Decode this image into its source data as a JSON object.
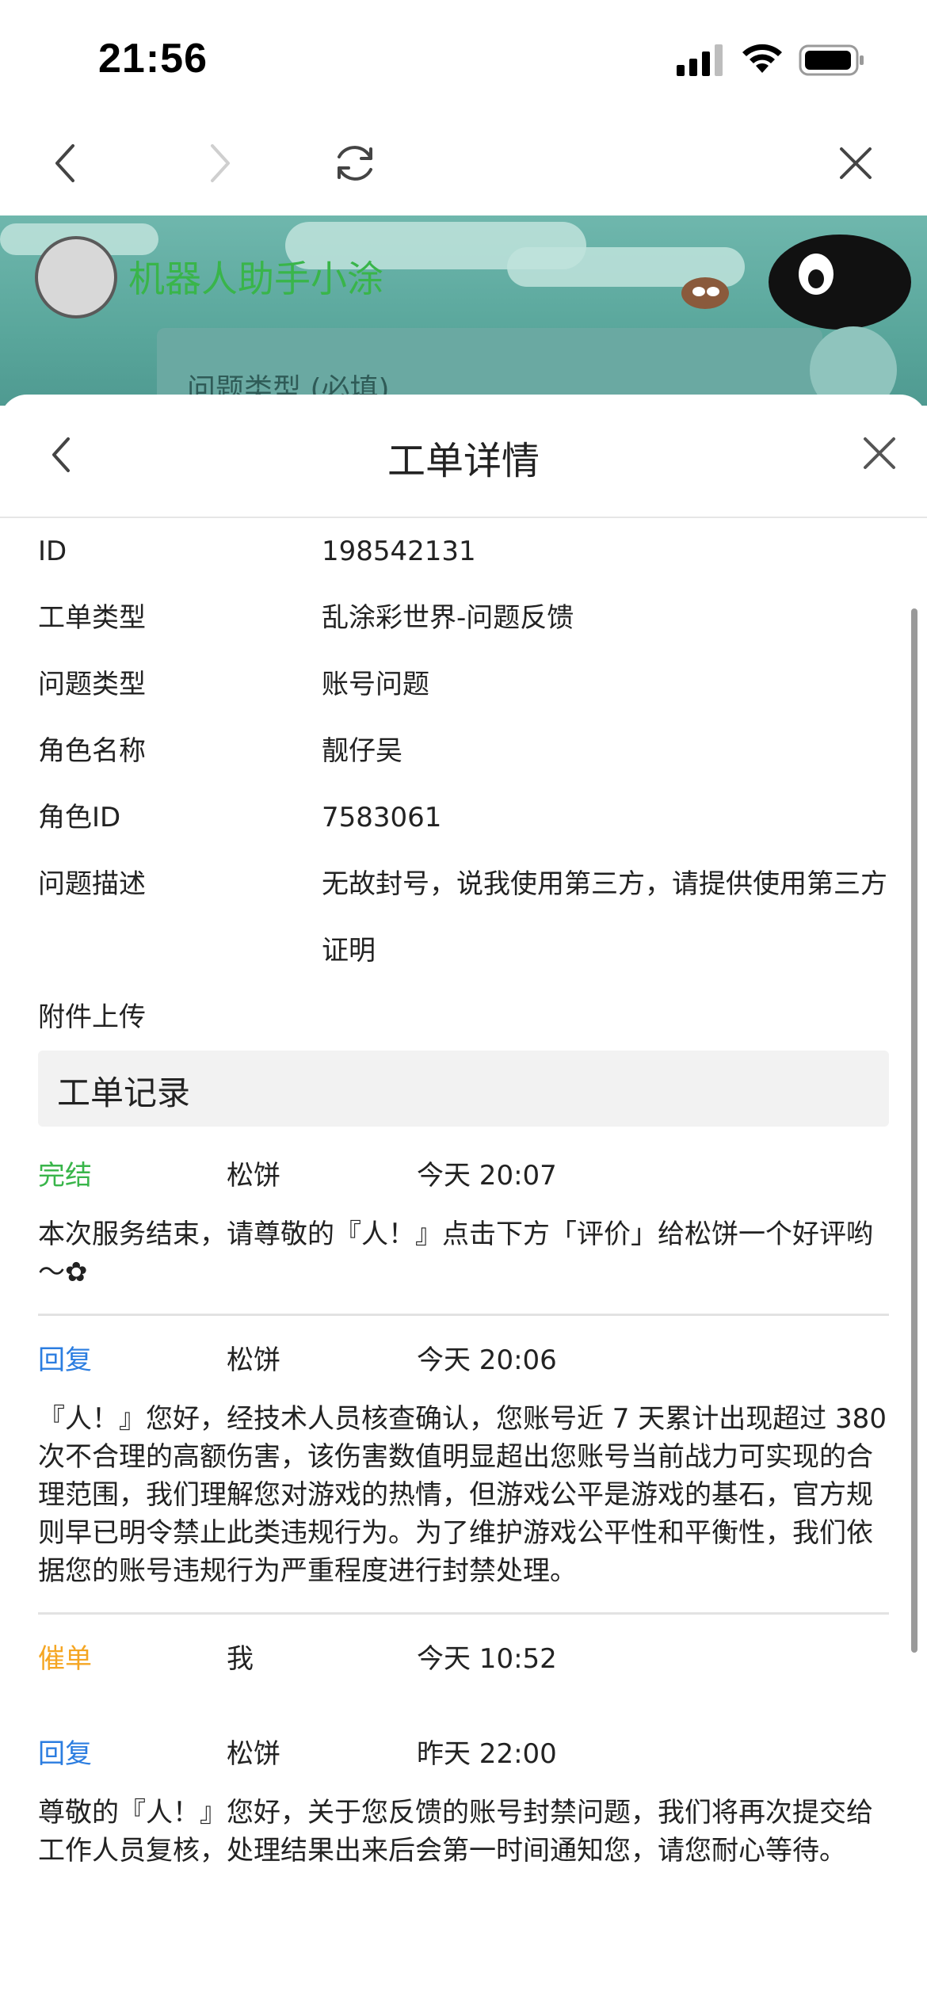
{
  "status_bar": {
    "time": "21:56"
  },
  "banner": {
    "title": "机器人助手小涂",
    "field_label": "问题类型 (必填)"
  },
  "sheet": {
    "title": "工单详情"
  },
  "info": [
    {
      "label": "ID",
      "value": "198542131"
    },
    {
      "label": "工单类型",
      "value": "乱涂彩世界-问题反馈"
    },
    {
      "label": "问题类型",
      "value": "账号问题"
    },
    {
      "label": "角色名称",
      "value": "靓仔吴"
    },
    {
      "label": "角色ID",
      "value": "7583061"
    },
    {
      "label": "问题描述",
      "value": "无故封号，说我使用第三方，请提供使用第三方证明"
    },
    {
      "label": "附件上传",
      "value": ""
    }
  ],
  "records_title": "工单记录",
  "records": [
    {
      "type": "完结",
      "user": "松饼",
      "time": "今天 20:07",
      "body": "本次服务结束，请尊敬的『人！』点击下方「评价」给松饼一个好评哟～✿"
    },
    {
      "type": "回复",
      "user": "松饼",
      "time": "今天 20:06",
      "body": "『人！』您好，经技术人员核查确认，您账号近 7 天累计出现超过 380 次不合理的高额伤害，该伤害数值明显超出您账号当前战力可实现的合理范围，我们理解您对游戏的热情，但游戏公平是游戏的基石，官方规则早已明令禁止此类违规行为。为了维护游戏公平性和平衡性，我们依据您的账号违规行为严重程度进行封禁处理。"
    },
    {
      "type": "催单",
      "user": "我",
      "time": "今天 10:52",
      "body": ""
    },
    {
      "type": "回复",
      "user": "松饼",
      "time": "昨天 22:00",
      "body": "尊敬的『人！』您好，关于您反馈的账号封禁问题，我们将再次提交给工作人员复核，处理结果出来后会第一时间通知您，请您耐心等待。"
    }
  ],
  "colors": {
    "done": "#39b54a",
    "reply": "#2b7de0",
    "urge": "#f5a623"
  }
}
